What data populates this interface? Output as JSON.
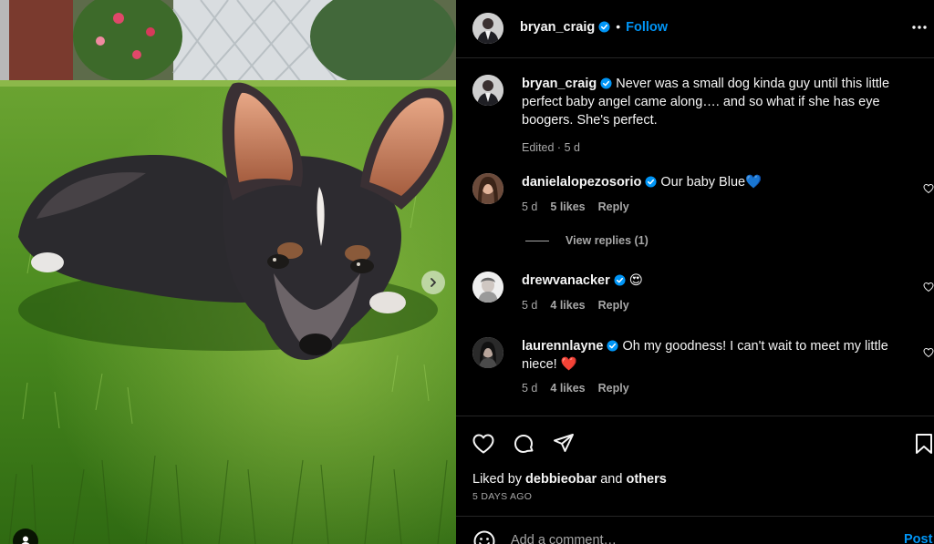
{
  "post": {
    "author": "bryan_craig",
    "follow_label": "Follow",
    "dot": "•",
    "caption": "Never was a small dog kinda guy until this little perfect baby angel came along…. and so what if she has eye boogers. She's perfect.",
    "edited_label": "Edited",
    "edited_time": "5 d"
  },
  "comments": [
    {
      "user": "danielalopezosorio",
      "text": "Our baby Blue💙",
      "time": "5 d",
      "likes": "5 likes",
      "reply": "Reply"
    },
    {
      "user": "drewvanacker",
      "text": "😍",
      "time": "5 d",
      "likes": "4 likes",
      "reply": "Reply"
    },
    {
      "user": "laurennlayne",
      "text": "Oh my goodness! I can't wait to meet my little niece! ❤️",
      "time": "5 d",
      "likes": "4 likes",
      "reply": "Reply"
    }
  ],
  "view_replies": "View replies (1)",
  "likes": {
    "prefix": "Liked by",
    "user": "debbieobar",
    "and": "and",
    "others": "others"
  },
  "date": "5 DAYS AGO",
  "add_comment": {
    "placeholder": "Add a comment…",
    "post_label": "Post"
  },
  "icons": {
    "verified": "verified-badge-icon",
    "more": "more-options-icon",
    "like": "heart-icon",
    "comment": "comment-icon",
    "share": "send-icon",
    "save": "bookmark-icon",
    "emoji": "smiley-icon",
    "next": "chevron-right-icon",
    "tag": "user-tag-icon"
  },
  "colors": {
    "accent": "#0095f6",
    "background": "#000000",
    "muted": "#a8a8a8"
  }
}
